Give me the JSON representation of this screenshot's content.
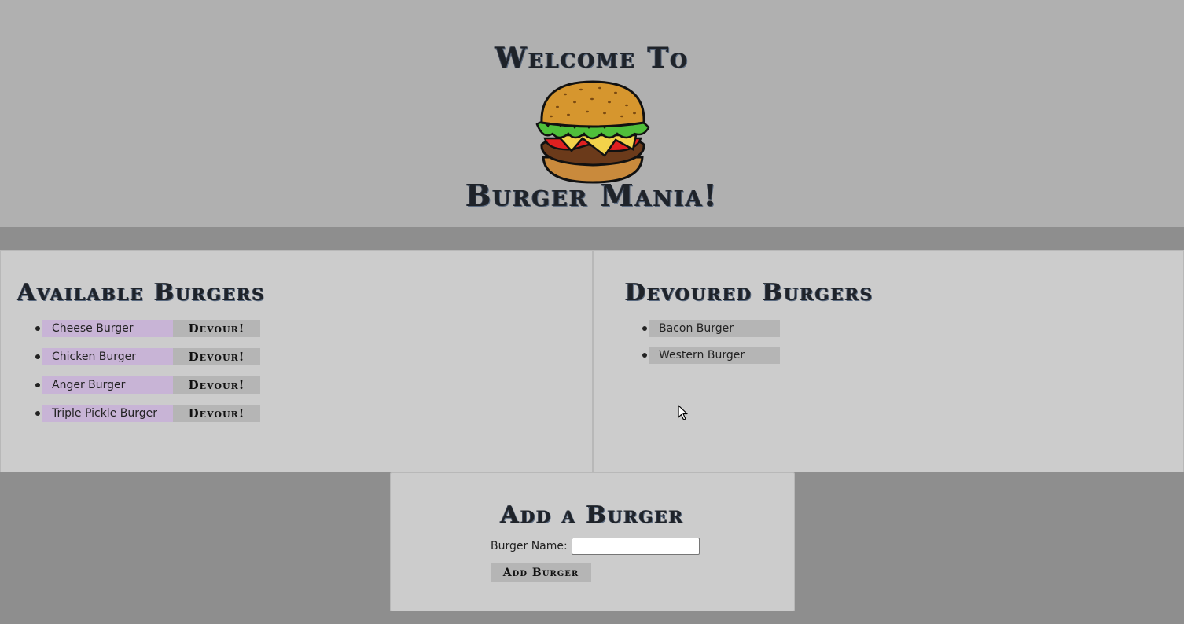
{
  "hero": {
    "welcome": "Welcome To",
    "title": "Burger Mania!",
    "logo_icon": "burger-icon"
  },
  "available": {
    "heading": "Available Burgers",
    "items": [
      {
        "name": "Cheese Burger",
        "action": "Devour!"
      },
      {
        "name": "Chicken Burger",
        "action": "Devour!"
      },
      {
        "name": "Anger Burger",
        "action": "Devour!"
      },
      {
        "name": "Triple Pickle Burger",
        "action": "Devour!"
      }
    ]
  },
  "devoured": {
    "heading": "Devoured Burgers",
    "items": [
      {
        "name": "Bacon Burger"
      },
      {
        "name": "Western Burger"
      }
    ]
  },
  "add_form": {
    "heading": "Add a Burger",
    "label": "Burger Name:",
    "input_value": "",
    "button_label": "Add Burger"
  },
  "colors": {
    "page_bg": "#8e8e8e",
    "hero_bg": "#b0b0b0",
    "panel_bg": "#cccccc",
    "available_item_bg": "#c8b4d6",
    "button_bg": "#b5b5b5"
  }
}
